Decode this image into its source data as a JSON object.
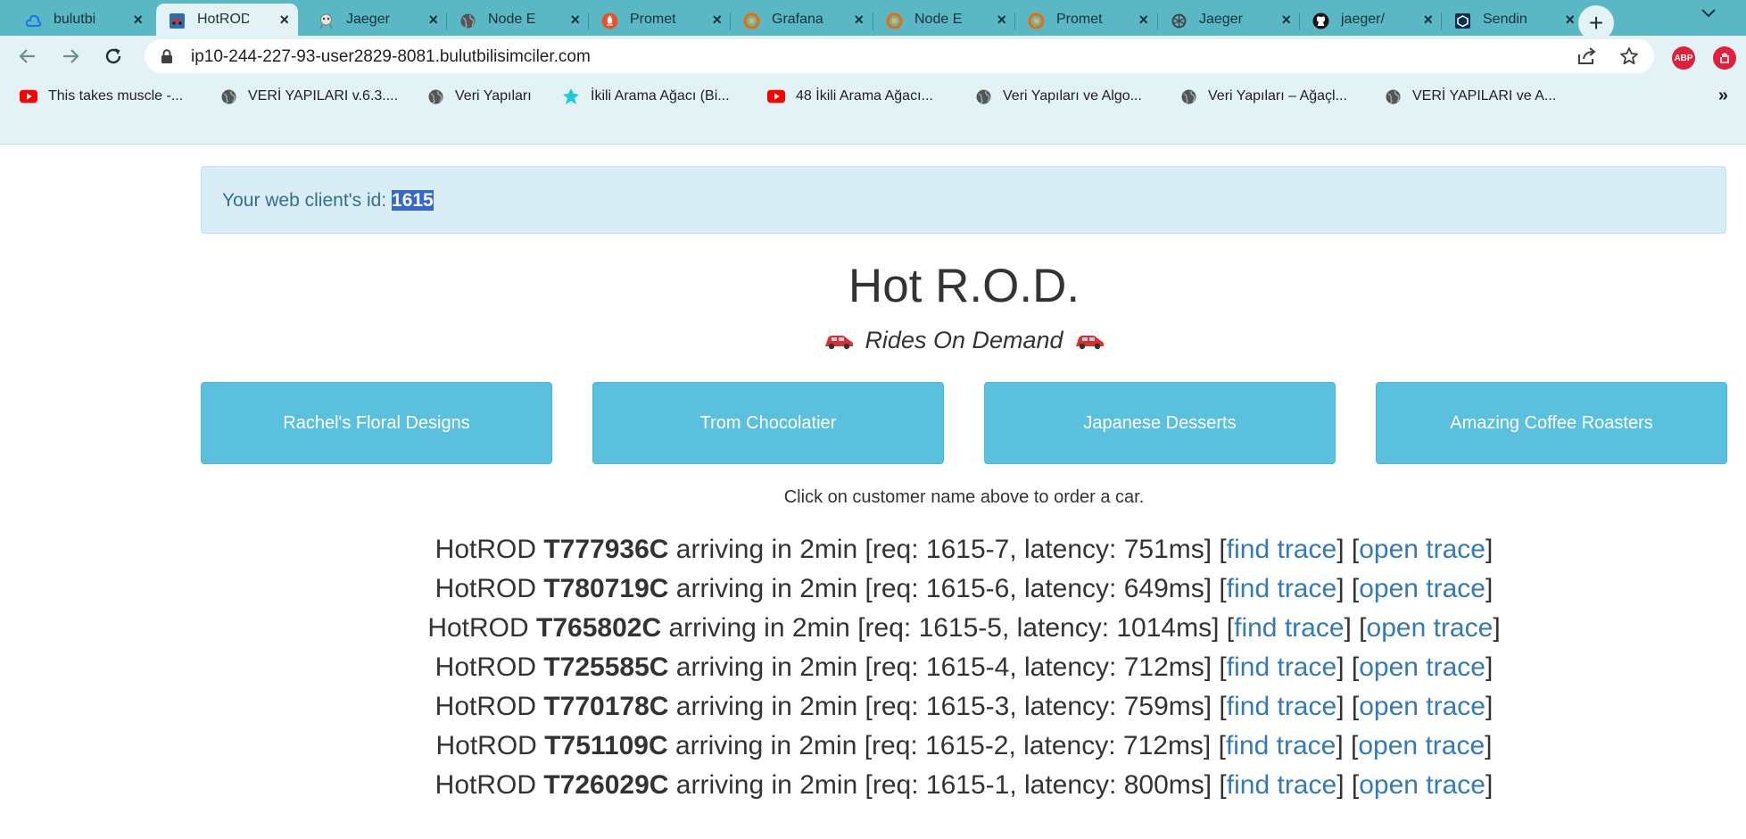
{
  "browser": {
    "tabs": [
      {
        "title": "bulutbi",
        "icon": "cloud-icon"
      },
      {
        "title": "HotROD",
        "icon": "car-icon",
        "active": true
      },
      {
        "title": "Jaeger",
        "icon": "jaeger-icon"
      },
      {
        "title": "Node E",
        "icon": "globe-icon"
      },
      {
        "title": "Promet",
        "icon": "prometheus-icon"
      },
      {
        "title": "Grafana",
        "icon": "grafana-icon"
      },
      {
        "title": "Node E",
        "icon": "grafana-icon"
      },
      {
        "title": "Promet",
        "icon": "grafana-icon"
      },
      {
        "title": "Jaeger",
        "icon": "openai-icon"
      },
      {
        "title": "jaeger/",
        "icon": "github-icon"
      },
      {
        "title": "Sendin",
        "icon": "cube-icon"
      }
    ],
    "url": "ip10-244-227-93-user2829-8081.bulutbilisimciler.com",
    "extensions": [
      "ABP"
    ],
    "bookmarks": [
      {
        "label": "This takes muscle -...",
        "icon": "youtube-icon"
      },
      {
        "label": "VERİ YAPILARI v.6.3....",
        "icon": "globe-icon"
      },
      {
        "label": "Veri Yapıları",
        "icon": "globe-icon"
      },
      {
        "label": "İkili Arama Ağacı (Bi...",
        "icon": "pin-icon"
      },
      {
        "label": "48 İkili Arama Ağacı...",
        "icon": "youtube-icon"
      },
      {
        "label": "Veri Yapıları ve Algo...",
        "icon": "globe-icon"
      },
      {
        "label": "Veri Yapıları – Ağaçl...",
        "icon": "globe-icon"
      },
      {
        "label": "VERİ YAPILARI ve A...",
        "icon": "globe-icon"
      }
    ],
    "bookmarks_more": "»"
  },
  "page": {
    "client_id_label": "Your web client's id:",
    "client_id": "1615",
    "title": "Hot R.O.D.",
    "subtitle": "Rides On Demand",
    "customers": [
      "Rachel's Floral Designs",
      "Trom Chocolatier",
      "Japanese Desserts",
      "Amazing Coffee Roasters"
    ],
    "hint": "Click on customer name above to order a car.",
    "ride_prefix": "HotROD",
    "ride_mid": "arriving in 2min [req:",
    "find_trace": "find trace",
    "open_trace": "open trace",
    "rides": [
      {
        "car": "T777936C",
        "req": "1615-7",
        "latency": "751ms"
      },
      {
        "car": "T780719C",
        "req": "1615-6",
        "latency": "649ms"
      },
      {
        "car": "T765802C",
        "req": "1615-5",
        "latency": "1014ms"
      },
      {
        "car": "T725585C",
        "req": "1615-4",
        "latency": "712ms"
      },
      {
        "car": "T770178C",
        "req": "1615-3",
        "latency": "759ms"
      },
      {
        "car": "T751109C",
        "req": "1615-2",
        "latency": "712ms"
      },
      {
        "car": "T726029C",
        "req": "1615-1",
        "latency": "800ms"
      }
    ]
  },
  "colors": {
    "chrome_frame": "#5ab8c4",
    "chrome_toolbar": "#e3f3f5",
    "alert_bg": "#d9edf7",
    "alert_text": "#31708f",
    "button_info": "#5bc0de",
    "link": "#337ab7",
    "selection": "#3367d6"
  }
}
